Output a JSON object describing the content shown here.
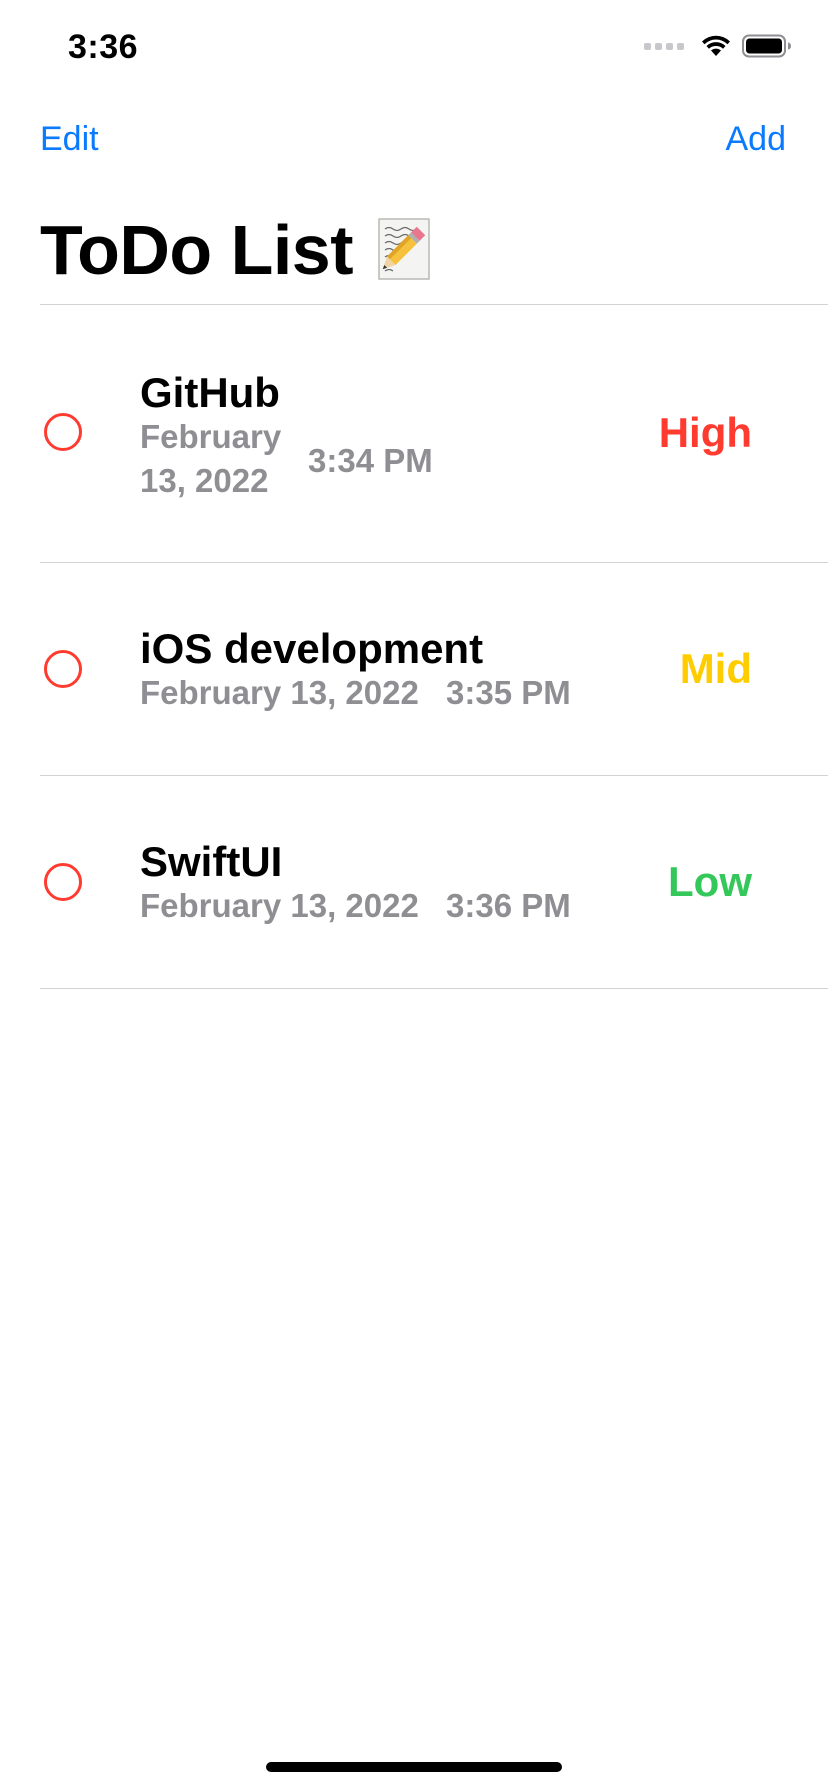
{
  "status_bar": {
    "time": "3:36",
    "icons": [
      "cellular-signal-icon",
      "wifi-icon",
      "battery-icon"
    ]
  },
  "nav": {
    "edit_label": "Edit",
    "add_label": "Add",
    "accent_color": "#0a7aff"
  },
  "page": {
    "title": "ToDo List",
    "title_icon": "memo-pencil-icon"
  },
  "items": [
    {
      "title": "GitHub",
      "date": "February 13, 2022",
      "time": "3:34 PM",
      "priority": "High",
      "priority_color": "#ff3b30",
      "completed": false
    },
    {
      "title": "iOS development",
      "date": "February 13, 2022",
      "time": "3:35 PM",
      "priority": "Mid",
      "priority_color": "#ffcc00",
      "completed": false
    },
    {
      "title": "SwiftUI",
      "date": "February 13, 2022",
      "time": "3:36 PM",
      "priority": "Low",
      "priority_color": "#34c759",
      "completed": false
    }
  ]
}
